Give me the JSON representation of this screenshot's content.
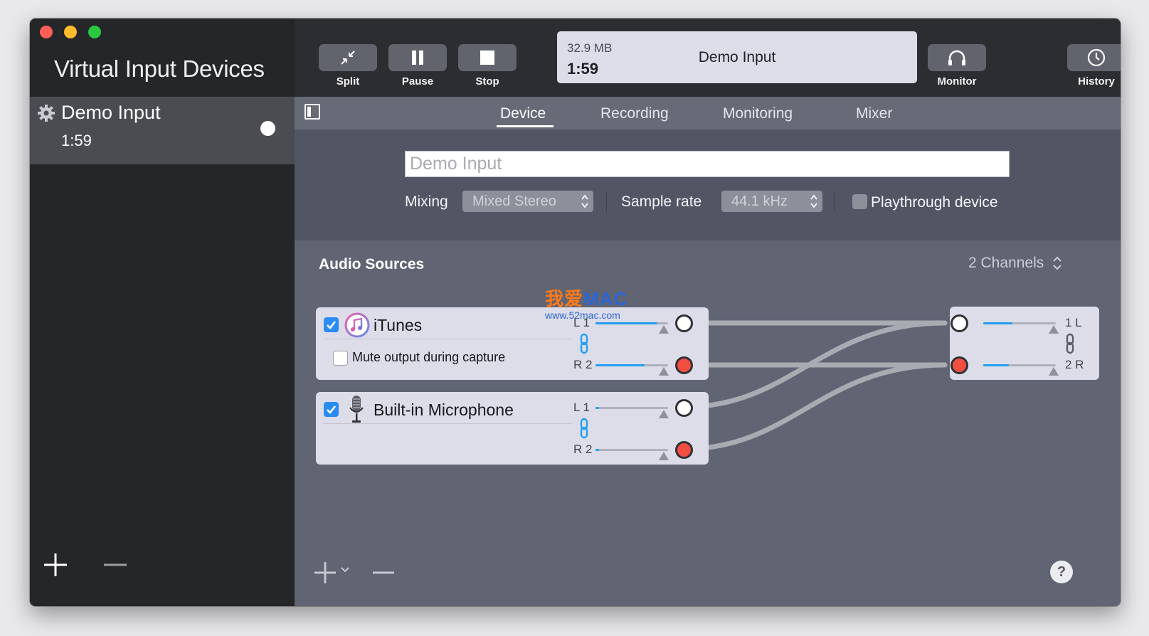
{
  "sidebar": {
    "title": "Virtual Input Devices",
    "devices": [
      {
        "name": "Demo Input",
        "time": "1:59"
      }
    ]
  },
  "toolbar": {
    "split_label": "Split",
    "pause_label": "Pause",
    "stop_label": "Stop",
    "monitor_label": "Monitor",
    "history_label": "History",
    "status": {
      "size": "32.9 MB",
      "time": "1:59",
      "name": "Demo Input"
    }
  },
  "tabs": [
    "Device",
    "Recording",
    "Monitoring",
    "Mixer"
  ],
  "device": {
    "name_value": "Demo Input",
    "mixing_label": "Mixing",
    "mixing_value": "Mixed Stereo",
    "sample_rate_label": "Sample rate",
    "sample_rate_value": "44.1 kHz",
    "playthrough_label": "Playthrough device"
  },
  "audio_sources": {
    "title": "Audio Sources",
    "channels": "2 Channels",
    "sources": [
      {
        "name": "iTunes",
        "mute_label": "Mute output during capture",
        "l_label": "L 1",
        "r_label": "R 2",
        "l_level": 0.85,
        "r_level": 0.68
      },
      {
        "name": "Built-in Microphone",
        "l_label": "L 1",
        "r_label": "R 2",
        "l_level": 0.05,
        "r_level": 0.05
      }
    ],
    "output": {
      "l_label": "1 L",
      "r_label": "2 R",
      "l_level": 0.4,
      "r_level": 0.35
    }
  },
  "help_label": "?",
  "watermark": {
    "text_cn": "我爱",
    "text_mac": "MAC",
    "url": "www.52mac.com"
  },
  "colors": {
    "accent": "#239ef0",
    "port_red": "#f24e41",
    "checkbox": "#2a8cf2"
  },
  "icons": [
    "gear-icon",
    "split-icon",
    "pause-icon",
    "stop-icon",
    "headphones-icon",
    "clock-icon",
    "sidebar-toggle-icon",
    "itunes-icon",
    "microphone-icon",
    "link-icon",
    "plus-icon",
    "minus-icon",
    "chevron-down-icon",
    "up-down-arrows-icon"
  ]
}
